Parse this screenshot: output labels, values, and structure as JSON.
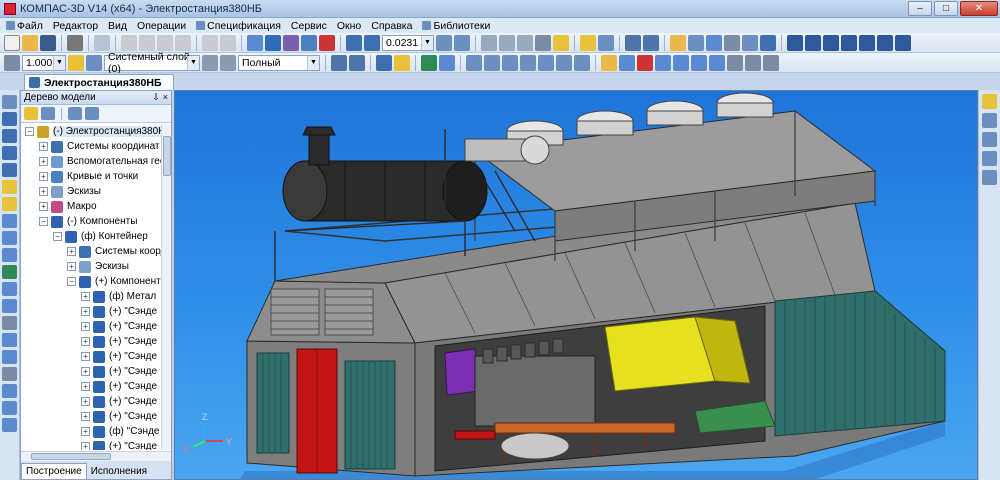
{
  "window": {
    "title": "КОМПАС-3D V14 (x64) - Электростанция380НБ",
    "minimize": "–",
    "maximize": "□",
    "close": "✕"
  },
  "menu": [
    "Файл",
    "Редактор",
    "Вид",
    "Операции",
    "Спецификация",
    "Сервис",
    "Окно",
    "Справка",
    "Библиотеки"
  ],
  "toolbar": {
    "zoom_value": "0.0231",
    "scale_value": "1.000",
    "layer_value": "Системный слой (0)",
    "display_mode": "Полный"
  },
  "document_tab": {
    "label": "Электростанция380НБ"
  },
  "tree_panel": {
    "title": "Дерево модели",
    "pin": "⇩",
    "close": "×",
    "items": [
      {
        "label": "(-) Электростанция380НБ (Т",
        "indent": 0,
        "expand": "−",
        "color": "#c9a227"
      },
      {
        "label": "Системы координат",
        "indent": 1,
        "expand": "+",
        "color": "#3d6fb3"
      },
      {
        "label": "Вспомогательная геоме",
        "indent": 1,
        "expand": "+",
        "color": "#6a9ad1"
      },
      {
        "label": "Кривые и точки",
        "indent": 1,
        "expand": "+",
        "color": "#4a80c2"
      },
      {
        "label": "Эскизы",
        "indent": 1,
        "expand": "+",
        "color": "#7fa1c9"
      },
      {
        "label": "Макро",
        "indent": 1,
        "expand": "+",
        "color": "#c04b86"
      },
      {
        "label": "(-) Компоненты",
        "indent": 1,
        "expand": "−",
        "color": "#2d63b0"
      },
      {
        "label": "(ф) Контейнер",
        "indent": 2,
        "expand": "−",
        "color": "#2d63b0"
      },
      {
        "label": "Системы коорд",
        "indent": 3,
        "expand": "+",
        "color": "#3d6fb3"
      },
      {
        "label": "Эскизы",
        "indent": 3,
        "expand": "+",
        "color": "#7fa1c9"
      },
      {
        "label": "(+) Компонент",
        "indent": 3,
        "expand": "−",
        "color": "#2d63b0"
      },
      {
        "label": "(ф) Метал",
        "indent": 4,
        "expand": "+",
        "color": "#2d63b0"
      },
      {
        "label": "(+) \"Сэнде",
        "indent": 4,
        "expand": "+",
        "color": "#2d63b0"
      },
      {
        "label": "(+) \"Сэнде",
        "indent": 4,
        "expand": "+",
        "color": "#2d63b0"
      },
      {
        "label": "(+) \"Сэнде",
        "indent": 4,
        "expand": "+",
        "color": "#2d63b0"
      },
      {
        "label": "(+) \"Сэнде",
        "indent": 4,
        "expand": "+",
        "color": "#2d63b0"
      },
      {
        "label": "(+) \"Сэнде",
        "indent": 4,
        "expand": "+",
        "color": "#2d63b0"
      },
      {
        "label": "(+) \"Сэнде",
        "indent": 4,
        "expand": "+",
        "color": "#2d63b0"
      },
      {
        "label": "(+) \"Сэнде",
        "indent": 4,
        "expand": "+",
        "color": "#2d63b0"
      },
      {
        "label": "(+) \"Сэнде",
        "indent": 4,
        "expand": "+",
        "color": "#2d63b0"
      },
      {
        "label": "(ф) \"Сэнде",
        "indent": 4,
        "expand": "+",
        "color": "#2d63b0"
      },
      {
        "label": "(+) \"Сэнде",
        "indent": 4,
        "expand": "+",
        "color": "#2d63b0"
      }
    ],
    "tabs": [
      "Построение",
      "Исполнения"
    ]
  },
  "viewport": {
    "axis_labels": {
      "x": "X",
      "y": "Y",
      "z": "Z"
    },
    "colors": {
      "background_top": "#1f74d9",
      "background_bottom": "#4aa6f0",
      "housing": "#8b8b8b",
      "teal_panel": "#2f6e6a",
      "door": "#c21414",
      "engine": "#6a6a6a",
      "generator": "#e6e020"
    }
  }
}
